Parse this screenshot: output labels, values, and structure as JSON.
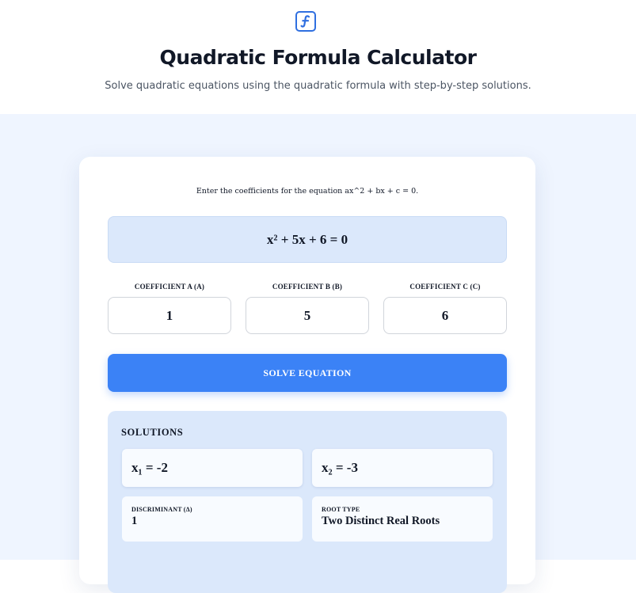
{
  "header": {
    "logo_icon": "function-icon",
    "title": "Quadratic Formula Calculator",
    "subtitle": "Solve quadratic equations using the quadratic formula with step-by-step solutions."
  },
  "calculator": {
    "instructions": "Enter the coefficients for the equation ax^2 + bx + c = 0.",
    "equation_display": "x² + 5x + 6 = 0",
    "coefficients": [
      {
        "label": "COEFFICIENT A (A)",
        "value": "1"
      },
      {
        "label": "COEFFICIENT B (B)",
        "value": "5"
      },
      {
        "label": "COEFFICIENT C (C)",
        "value": "6"
      }
    ],
    "solve_label": "SOLVE EQUATION"
  },
  "solutions": {
    "heading": "SOLUTIONS",
    "x1": "x₁ = -2",
    "x2": "x₂ = -3",
    "discriminant_label": "DISCRIMINANT (Δ)",
    "discriminant_value": "1",
    "root_type_label": "ROOT TYPE",
    "root_type_value": "Two Distinct Real Roots"
  },
  "colors": {
    "accent": "#3b82f6",
    "panel": "#dbe8fb",
    "page_background": "#eff5ff",
    "logo": "#2f6fe0"
  }
}
